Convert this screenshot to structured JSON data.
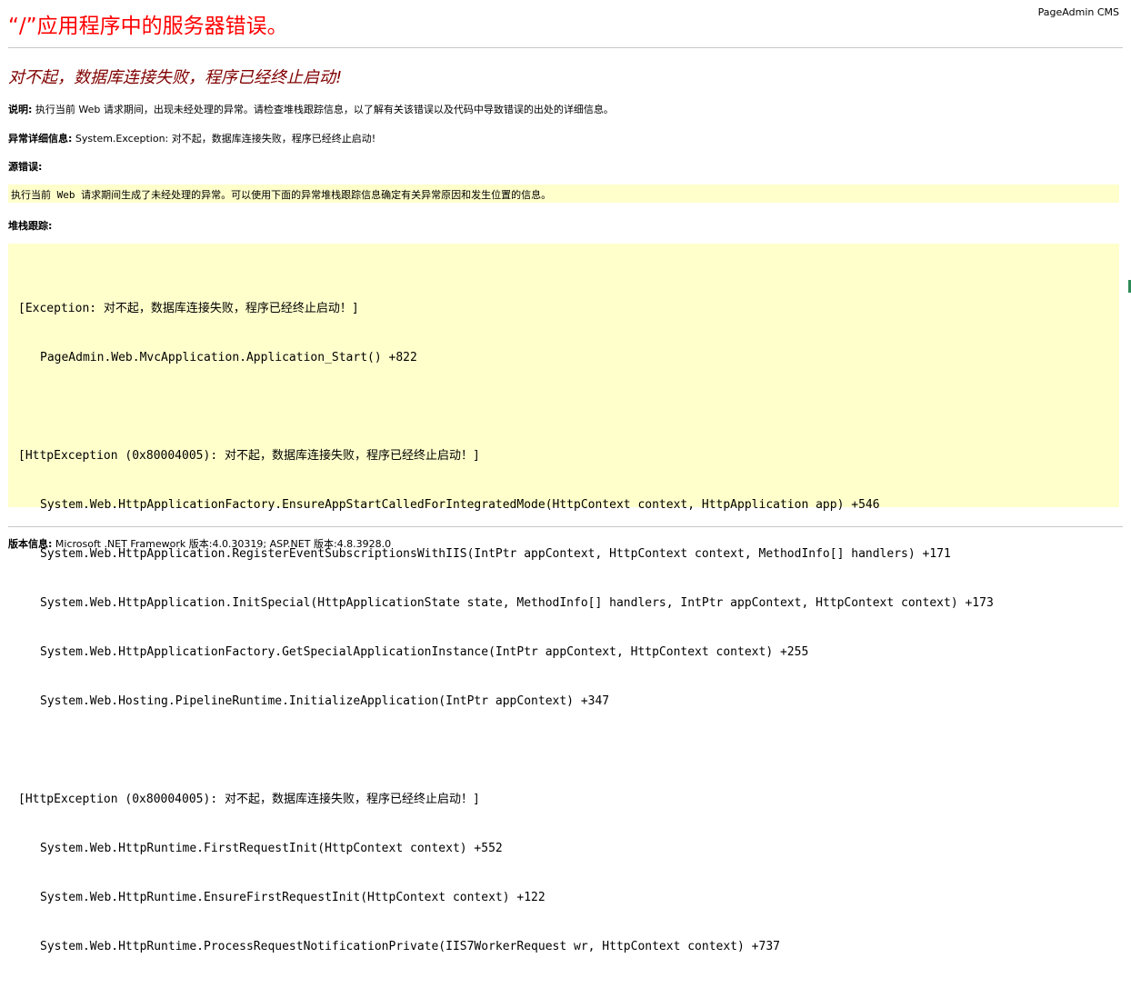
{
  "header": {
    "title": "“/”应用程序中的服务器错误。",
    "brand": "PageAdmin CMS"
  },
  "error": {
    "heading": "对不起，数据库连接失败，程序已经终止启动!",
    "description_label": "说明:",
    "description_text": " 执行当前 Web 请求期间，出现未经处理的异常。请检查堆栈跟踪信息，以了解有关该错误以及代码中导致错误的出处的详细信息。",
    "exception_label": "异常详细信息:",
    "exception_text": " System.Exception: 对不起，数据库连接失败，程序已经终止启动!",
    "source_label": "源错误:",
    "source_text": "执行当前 Web 请求期间生成了未经处理的异常。可以使用下面的异常堆栈跟踪信息确定有关异常原因和发生位置的信息。",
    "stack_label": "堆栈跟踪:"
  },
  "stack_trace": {
    "group1_header": "[Exception: 对不起，数据库连接失败，程序已经终止启动！]",
    "group1_lines": [
      "PageAdmin.Web.MvcApplication.Application_Start() +822"
    ],
    "group2_header": "[HttpException (0x80004005): 对不起，数据库连接失败，程序已经终止启动！]",
    "group2_lines": [
      "System.Web.HttpApplicationFactory.EnsureAppStartCalledForIntegratedMode(HttpContext context, HttpApplication app) +546",
      "System.Web.HttpApplication.RegisterEventSubscriptionsWithIIS(IntPtr appContext, HttpContext context, MethodInfo[] handlers) +171",
      "System.Web.HttpApplication.InitSpecial(HttpApplicationState state, MethodInfo[] handlers, IntPtr appContext, HttpContext context) +173",
      "System.Web.HttpApplicationFactory.GetSpecialApplicationInstance(IntPtr appContext, HttpContext context) +255",
      "System.Web.Hosting.PipelineRuntime.InitializeApplication(IntPtr appContext) +347"
    ],
    "group3_header": "[HttpException (0x80004005): 对不起，数据库连接失败，程序已经终止启动！]",
    "group3_lines": [
      "System.Web.HttpRuntime.FirstRequestInit(HttpContext context) +552",
      "System.Web.HttpRuntime.EnsureFirstRequestInit(HttpContext context) +122",
      "System.Web.HttpRuntime.ProcessRequestNotificationPrivate(IIS7WorkerRequest wr, HttpContext context) +737"
    ]
  },
  "footer": {
    "version_label": "版本信息:",
    "version_text": " Microsoft .NET Framework 版本:4.0.30319; ASP.NET 版本:4.8.3928.0"
  },
  "colors": {
    "title": "#ff0000",
    "heading": "#800000",
    "code_background": "#ffffcc",
    "rule": "#c8c8c8",
    "edge_accent": "#2e8b57"
  }
}
